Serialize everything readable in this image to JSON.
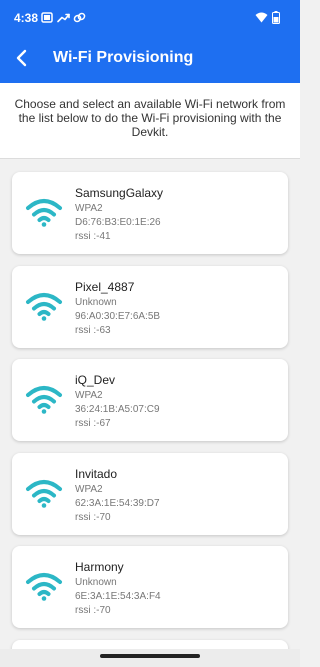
{
  "status_bar": {
    "time": "4:38",
    "left_icons": [
      "screen-icon",
      "trend-icon",
      "link-icon"
    ],
    "right_icons": [
      "wifi-signal-icon",
      "battery-icon"
    ]
  },
  "app_bar": {
    "title": "Wi-Fi Provisioning",
    "back_icon": "arrow-left-icon",
    "background": "#1e6ff1"
  },
  "intro": {
    "line1": "Choose and select an available Wi-Fi network from",
    "line2": "the list below to do the Wi-Fi provisioning with the",
    "line3": "Devkit."
  },
  "wifi_icon_color": "#2cb7c6",
  "networks": [
    {
      "name": "SamsungGalaxy",
      "security": "WPA2",
      "mac": "D6:76:B3:E0:1E:26",
      "rssi": "rssi :-41"
    },
    {
      "name": "Pixel_4887",
      "security": "Unknown",
      "mac": "96:A0:30:E7:6A:5B",
      "rssi": "rssi :-63"
    },
    {
      "name": "iQ_Dev",
      "security": "WPA2",
      "mac": "36:24:1B:A5:07:C9",
      "rssi": "rssi :-67"
    },
    {
      "name": "Invitado",
      "security": "WPA2",
      "mac": "62:3A:1E:54:39:D7",
      "rssi": "rssi :-70"
    },
    {
      "name": "Harmony",
      "security": "Unknown",
      "mac": "6E:3A:1E:54:3A:F4",
      "rssi": "rssi :-70"
    }
  ]
}
